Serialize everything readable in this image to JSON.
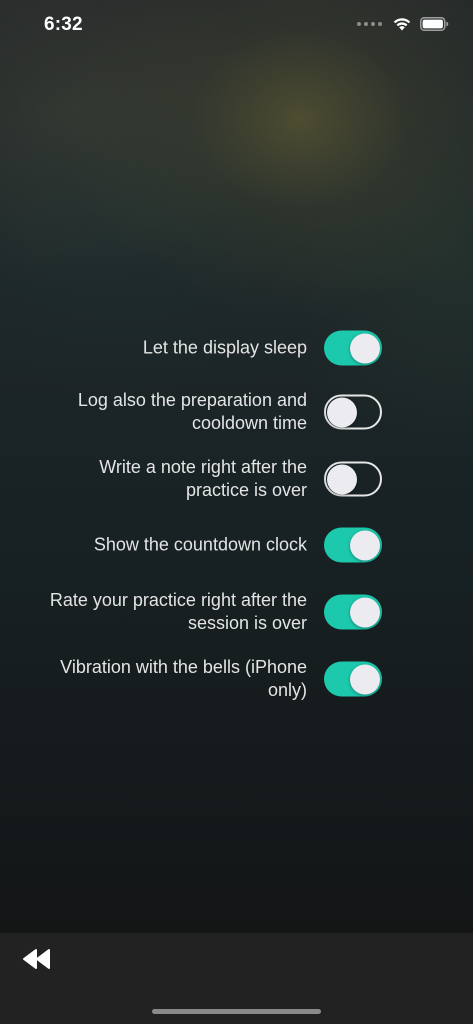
{
  "status_bar": {
    "time": "6:32",
    "icons": [
      "cellular-dots-icon",
      "wifi-icon",
      "battery-icon"
    ]
  },
  "settings": [
    {
      "label": "Let the display sleep",
      "enabled": true
    },
    {
      "label": "Log also the preparation and cooldown time",
      "enabled": false
    },
    {
      "label": "Write a note right after the practice is over",
      "enabled": false
    },
    {
      "label": "Show the countdown clock",
      "enabled": true
    },
    {
      "label": "Rate your practice right after the session is over",
      "enabled": true
    },
    {
      "label": "Vibration with the bells (iPhone only)",
      "enabled": true
    }
  ],
  "bottom_bar": {
    "back_icon": "rewind-back-icon"
  },
  "colors": {
    "toggle_on": "#1cc9ad",
    "bottom_bar": "#222222",
    "label_text": "#e4e4e4"
  }
}
